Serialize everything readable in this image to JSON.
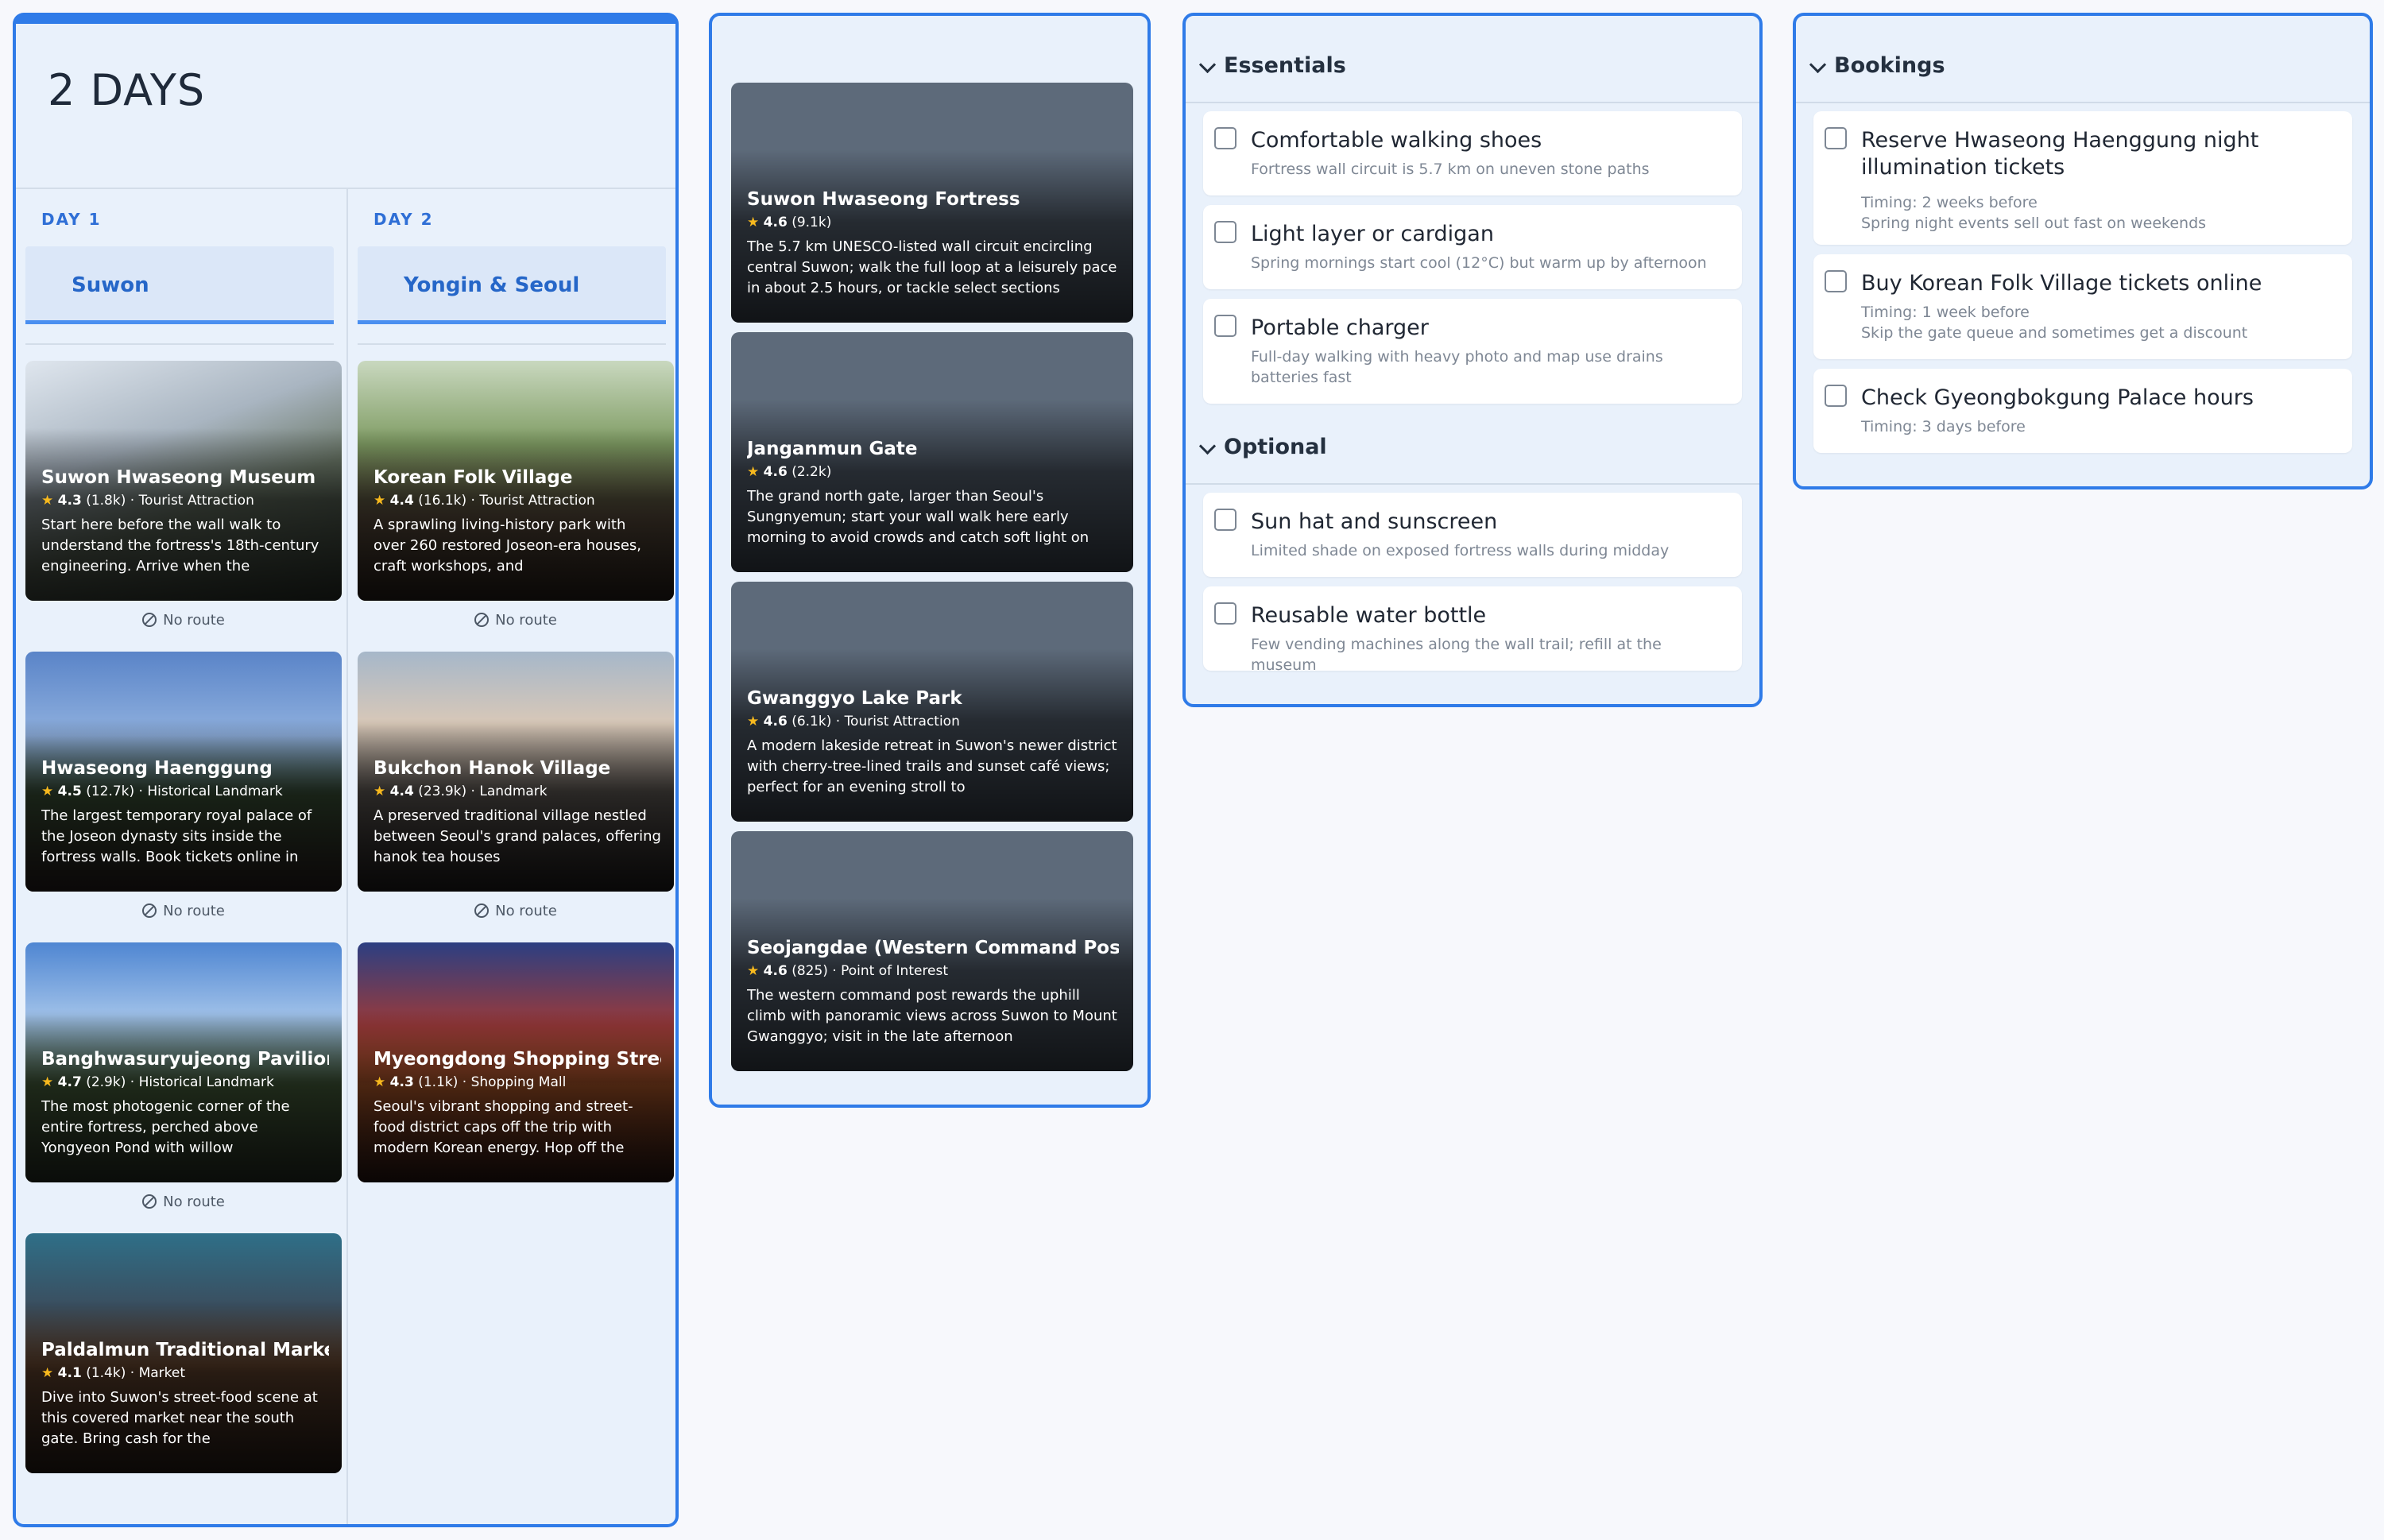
{
  "itinerary": {
    "title": "2 DAYS",
    "no_route_label": "No route",
    "days": [
      {
        "label": "DAY 1",
        "city": "Suwon",
        "places": [
          {
            "name": "Suwon Hwaseong Museum",
            "rating": "4.3",
            "reviews": "(1.8k)",
            "category": "Tourist Attraction",
            "desc": "Start here before the wall walk to understand the fortress's 18th-century engineering. Arrive when the"
          },
          {
            "name": "Hwaseong Haenggung",
            "rating": "4.5",
            "reviews": "(12.7k)",
            "category": "Historical Landmark",
            "desc": "The largest temporary royal palace of the Joseon dynasty sits inside the fortress walls. Book tickets online in"
          },
          {
            "name": "Banghwasuryujeong Pavilion",
            "rating": "4.7",
            "reviews": "(2.9k)",
            "category": "Historical Landmark",
            "desc": "The most photogenic corner of the entire fortress, perched above Yongyeon Pond with willow"
          },
          {
            "name": "Paldalmun Traditional Market",
            "rating": "4.1",
            "reviews": "(1.4k)",
            "category": "Market",
            "desc": "Dive into Suwon's street-food scene at this covered market near the south gate. Bring cash for the"
          }
        ]
      },
      {
        "label": "DAY 2",
        "city": "Yongin & Seoul",
        "places": [
          {
            "name": "Korean Folk Village",
            "rating": "4.4",
            "reviews": "(16.1k)",
            "category": "Tourist Attraction",
            "desc": "A sprawling living-history park with over 260 restored Joseon-era houses, craft workshops, and"
          },
          {
            "name": "Bukchon Hanok Village",
            "rating": "4.4",
            "reviews": "(23.9k)",
            "category": "Landmark",
            "desc": "A preserved traditional village nestled between Seoul's grand palaces, offering hanok tea houses"
          },
          {
            "name": "Myeongdong Shopping Street",
            "rating": "4.3",
            "reviews": "(1.1k)",
            "category": "Shopping Mall",
            "desc": "Seoul's vibrant shopping and street-food district caps off the trip with modern Korean energy. Hop off the"
          }
        ]
      }
    ]
  },
  "saved": [
    {
      "name": "Suwon Hwaseong Fortress",
      "rating": "4.6",
      "reviews": "(9.1k)",
      "category": "",
      "desc": "The 5.7 km UNESCO-listed wall circuit encircling central Suwon; walk the full loop at a leisurely pace in about 2.5 hours, or tackle select sections"
    },
    {
      "name": "Janganmun Gate",
      "rating": "4.6",
      "reviews": "(2.2k)",
      "category": "",
      "desc": "The grand north gate, larger than Seoul's Sungnyemun; start your wall walk here early morning to avoid crowds and catch soft light on"
    },
    {
      "name": "Gwanggyo Lake Park",
      "rating": "4.6",
      "reviews": "(6.1k)",
      "category": "Tourist Attraction",
      "desc": "A modern lakeside retreat in Suwon's newer district with cherry-tree-lined trails and sunset café views; perfect for an evening stroll to"
    },
    {
      "name": "Seojangdae (Western Command Post)",
      "rating": "4.6",
      "reviews": "(825)",
      "category": "Point of Interest",
      "desc": "The western command post rewards the uphill climb with panoramic views across Suwon to Mount Gwanggyo; visit in the late afternoon"
    }
  ],
  "packing": {
    "essentials_title": "Essentials",
    "essentials": [
      {
        "label": "Comfortable walking shoes",
        "note": "Fortress wall circuit is 5.7 km on uneven stone paths"
      },
      {
        "label": "Light layer or cardigan",
        "note": "Spring mornings start cool (12°C) but warm up by afternoon"
      },
      {
        "label": "Portable charger",
        "note": "Full-day walking with heavy photo and map use drains batteries fast"
      }
    ],
    "optional_title": "Optional",
    "optional": [
      {
        "label": "Sun hat and sunscreen",
        "note": "Limited shade on exposed fortress walls during midday"
      },
      {
        "label": "Reusable water bottle",
        "note": "Few vending machines along the wall trail; refill at the museum"
      }
    ]
  },
  "bookings": {
    "title": "Bookings",
    "items": [
      {
        "label": "Reserve Hwaseong Haenggung night illumination tickets",
        "timing": "Timing: 2 weeks before",
        "note": "Spring night events sell out fast on weekends"
      },
      {
        "label": "Buy Korean Folk Village tickets online",
        "timing": "Timing: 1 week before",
        "note": "Skip the gate queue and sometimes get a discount"
      },
      {
        "label": "Check Gyeongbokgung Palace hours",
        "timing": "Timing: 3 days before",
        "note": ""
      }
    ]
  }
}
